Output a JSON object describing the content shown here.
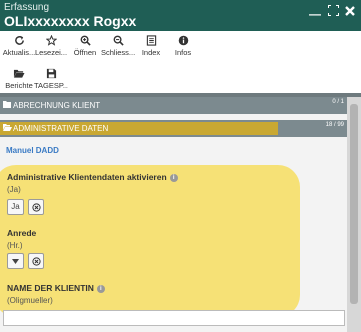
{
  "window": {
    "subtitle": "Erfassung",
    "title": "OLIxxxxxxxx Rogxx"
  },
  "toolbar": {
    "row1": [
      {
        "label": "Aktualis...",
        "icon": "refresh-icon"
      },
      {
        "label": "Lesezei...",
        "icon": "star-icon"
      },
      {
        "label": "Öffnen",
        "icon": "zoom-in-icon"
      },
      {
        "label": "Schliess...",
        "icon": "zoom-out-icon"
      },
      {
        "label": "Index",
        "icon": "index-icon"
      },
      {
        "label": "Infos",
        "icon": "info-icon"
      }
    ],
    "row2": [
      {
        "label": "Berichte",
        "icon": "folder-open-icon"
      },
      {
        "label": "TAGESP...",
        "icon": "save-icon"
      }
    ]
  },
  "sections": [
    {
      "label": "ABRECHNUNG KLIENT",
      "count": "0 / 1"
    },
    {
      "label": "ADMINISTRATIVE DATEN",
      "count": "18 / 99"
    }
  ],
  "subtitle": "Manuel DADD",
  "fields": {
    "f1": {
      "label": "Administrative Klientendaten aktivieren",
      "value": "(Ja)",
      "button": "Ja"
    },
    "f2": {
      "label": "Anrede",
      "value": "(Hr.)"
    },
    "f3": {
      "label": "NAME DER KLIENTIN",
      "value": "(Oligmueller)"
    }
  },
  "colors": {
    "titlebar": "#1f5e55",
    "section": "#7c8a8f",
    "section_highlight": "#c9a832",
    "highlight_marker": "#f6df6b",
    "link": "#3a7ac4"
  }
}
